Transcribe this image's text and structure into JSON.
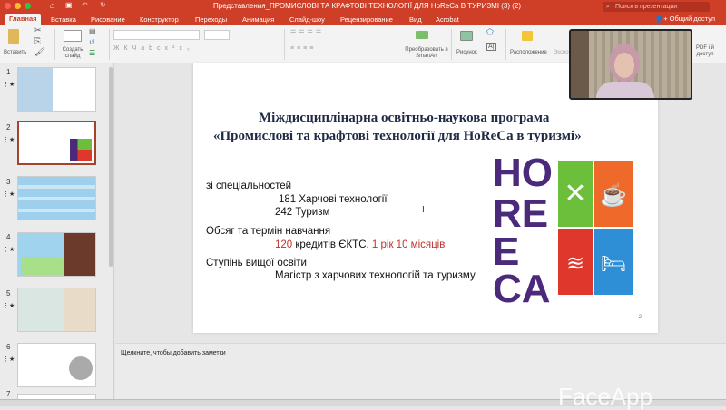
{
  "window": {
    "title": "Представления_ПРОМИСЛОВІ ТА КРАФТОВІ ТЕХНОЛОГІЇ ДЛЯ  HoReCa  В ТУРИЗМІ (3) (2)",
    "search_placeholder": "Поиск в презентации",
    "share": "Общий доступ"
  },
  "tabs": [
    "Главная",
    "Вставка",
    "Рисование",
    "Конструктор",
    "Переходы",
    "Анимация",
    "Слайд-шоу",
    "Рецензирование",
    "Вид",
    "Acrobat"
  ],
  "ribbon": {
    "paste": "Вставить",
    "new_slide": "Создать слайд",
    "smartart": "Преобразовать в SmartArt",
    "picture": "Рисунок",
    "arrange": "Расположение",
    "export": "Экспо",
    "pdf": "PDF і й доступ"
  },
  "thumbnails": [
    "1",
    "2",
    "3",
    "4",
    "5",
    "6",
    "7"
  ],
  "slide": {
    "title1": "Міждисциплінарна освітньо-наукова програма",
    "title2": "«Промислові та крафтові технології  для HoReCa в туризмі»",
    "spec_label": "зі спеціальностей",
    "spec1": "181 Харчові технології",
    "spec2": "242 Туризм",
    "volume_label": "Обсяг та термін навчання",
    "credits_num": "120",
    "credits_text": " кредитів ЄКТС, ",
    "duration": "1 рік 10 місяців",
    "degree_label": "Ступінь вищої освіти",
    "degree": "Магістр з харчових технологій та туризму",
    "page": "2",
    "logo_text": "HoReCa"
  },
  "notes_placeholder": "Щелкните, чтобы добавить заметки",
  "watermark": "FaceApp",
  "colors": {
    "accent": "#cf3f28",
    "logo_purple": "#4b2a7b",
    "green": "#6cbf3a",
    "orange": "#ef6a2a",
    "red": "#e0372c",
    "blue": "#2e8fd6"
  }
}
